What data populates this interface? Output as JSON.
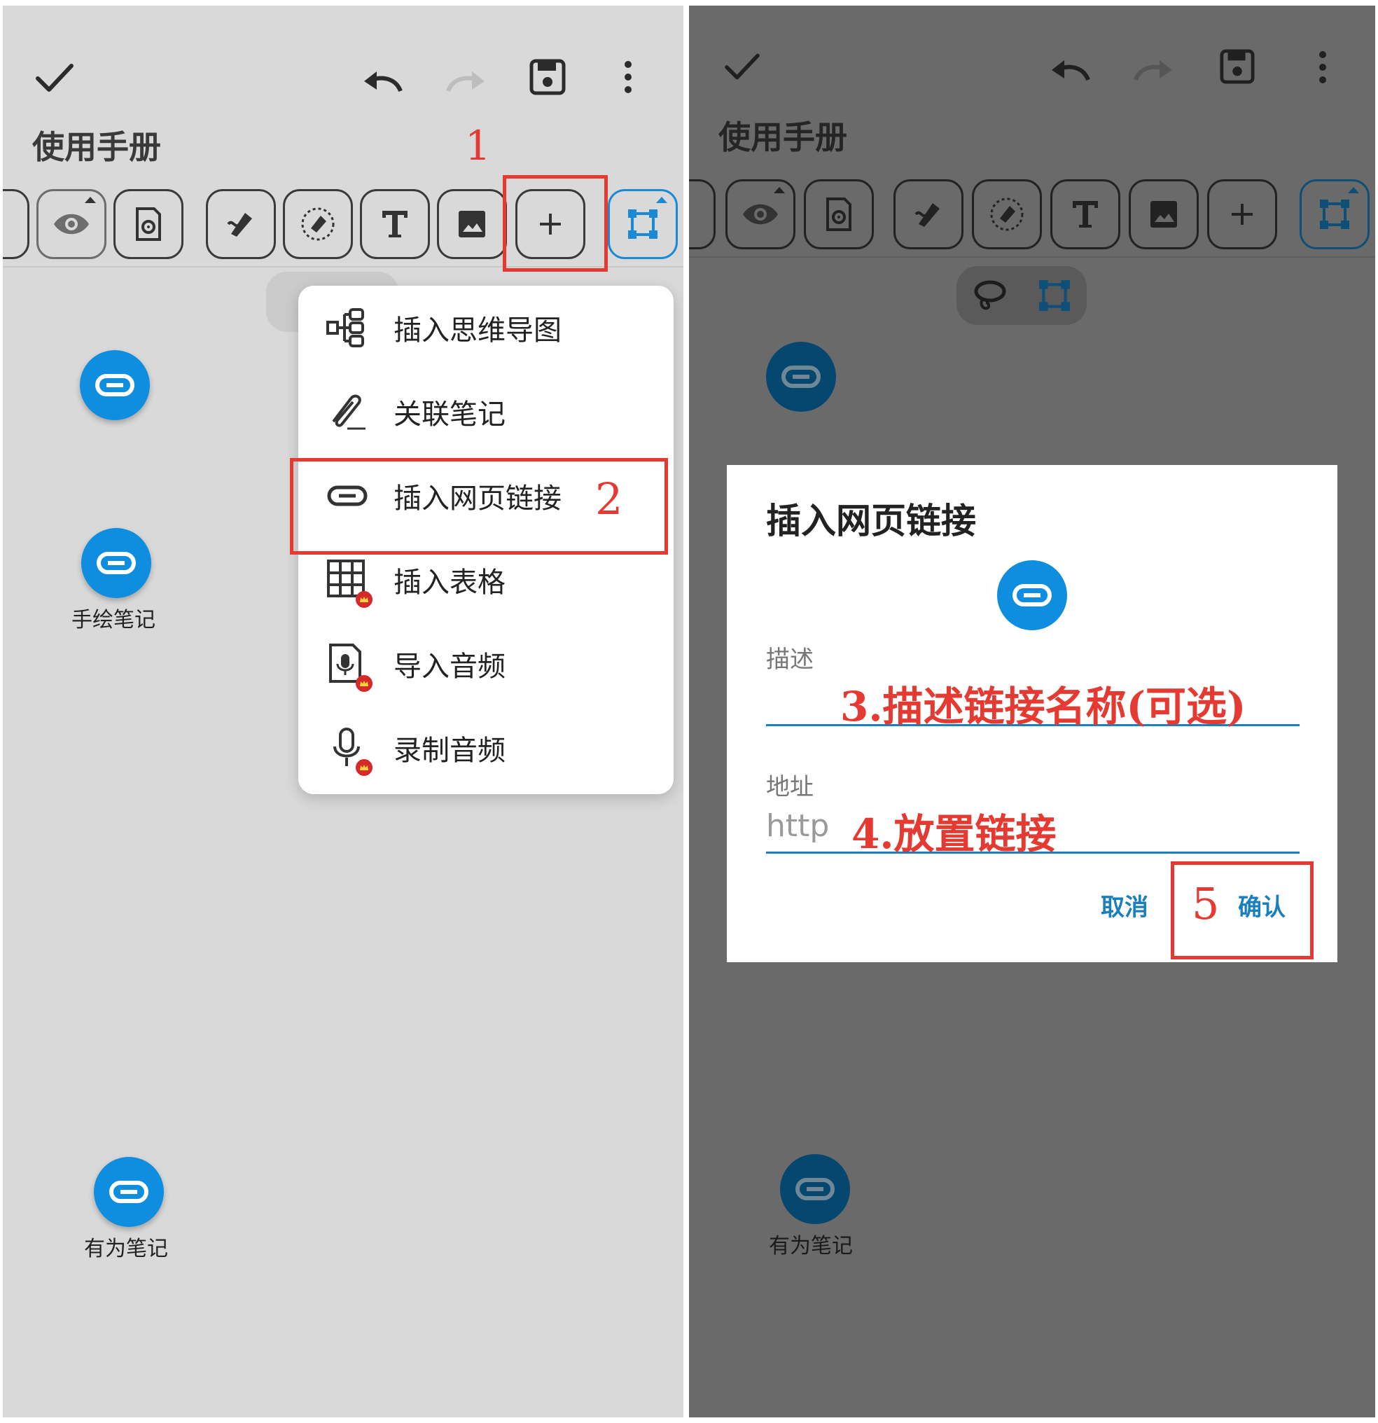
{
  "left": {
    "title": "使用手册",
    "link_nodes": [
      {
        "label": ""
      },
      {
        "label": "手绘笔记"
      },
      {
        "label": "有为笔记"
      }
    ],
    "menu": {
      "items": [
        {
          "label": "插入思维导图",
          "icon": "mindmap-icon",
          "premium": false
        },
        {
          "label": "关联笔记",
          "icon": "paperclip-icon",
          "premium": false
        },
        {
          "label": "插入网页链接",
          "icon": "link-icon",
          "premium": false
        },
        {
          "label": "插入表格",
          "icon": "table-icon",
          "premium": true
        },
        {
          "label": "导入音频",
          "icon": "audio-file-icon",
          "premium": true
        },
        {
          "label": "录制音频",
          "icon": "microphone-icon",
          "premium": true
        }
      ]
    },
    "annotations": {
      "step1": "1",
      "step2": "2"
    }
  },
  "right": {
    "title": "使用手册",
    "link_nodes": [
      {
        "label": ""
      },
      {
        "label": "有为笔记"
      }
    ],
    "dialog": {
      "title": "插入网页链接",
      "description_label": "描述",
      "address_label": "地址",
      "address_placeholder": "http",
      "cancel": "取消",
      "confirm": "确认"
    },
    "annotations": {
      "step3": "3.描述链接名称(可选)",
      "step4": "4.放置链接",
      "step5": "5"
    }
  },
  "colors": {
    "accent": "#0f8ee0",
    "annotation_red": "#e53a32",
    "dialog_button": "#1a7fbf"
  }
}
